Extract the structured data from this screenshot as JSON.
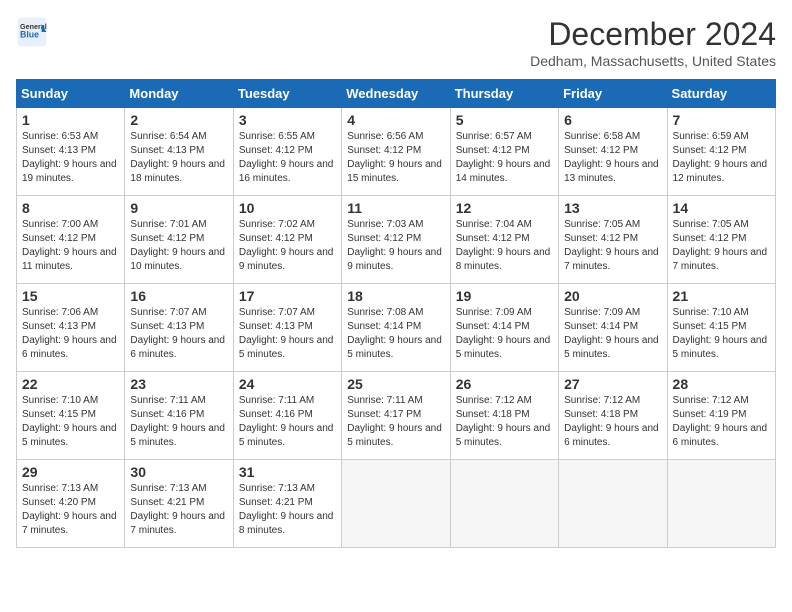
{
  "header": {
    "logo_line1": "General",
    "logo_line2": "Blue",
    "month": "December 2024",
    "location": "Dedham, Massachusetts, United States"
  },
  "weekdays": [
    "Sunday",
    "Monday",
    "Tuesday",
    "Wednesday",
    "Thursday",
    "Friday",
    "Saturday"
  ],
  "weeks": [
    [
      {
        "day": "1",
        "sunrise": "6:53 AM",
        "sunset": "4:13 PM",
        "daylight": "9 hours and 19 minutes."
      },
      {
        "day": "2",
        "sunrise": "6:54 AM",
        "sunset": "4:13 PM",
        "daylight": "9 hours and 18 minutes."
      },
      {
        "day": "3",
        "sunrise": "6:55 AM",
        "sunset": "4:12 PM",
        "daylight": "9 hours and 16 minutes."
      },
      {
        "day": "4",
        "sunrise": "6:56 AM",
        "sunset": "4:12 PM",
        "daylight": "9 hours and 15 minutes."
      },
      {
        "day": "5",
        "sunrise": "6:57 AM",
        "sunset": "4:12 PM",
        "daylight": "9 hours and 14 minutes."
      },
      {
        "day": "6",
        "sunrise": "6:58 AM",
        "sunset": "4:12 PM",
        "daylight": "9 hours and 13 minutes."
      },
      {
        "day": "7",
        "sunrise": "6:59 AM",
        "sunset": "4:12 PM",
        "daylight": "9 hours and 12 minutes."
      }
    ],
    [
      {
        "day": "8",
        "sunrise": "7:00 AM",
        "sunset": "4:12 PM",
        "daylight": "9 hours and 11 minutes."
      },
      {
        "day": "9",
        "sunrise": "7:01 AM",
        "sunset": "4:12 PM",
        "daylight": "9 hours and 10 minutes."
      },
      {
        "day": "10",
        "sunrise": "7:02 AM",
        "sunset": "4:12 PM",
        "daylight": "9 hours and 9 minutes."
      },
      {
        "day": "11",
        "sunrise": "7:03 AM",
        "sunset": "4:12 PM",
        "daylight": "9 hours and 9 minutes."
      },
      {
        "day": "12",
        "sunrise": "7:04 AM",
        "sunset": "4:12 PM",
        "daylight": "9 hours and 8 minutes."
      },
      {
        "day": "13",
        "sunrise": "7:05 AM",
        "sunset": "4:12 PM",
        "daylight": "9 hours and 7 minutes."
      },
      {
        "day": "14",
        "sunrise": "7:05 AM",
        "sunset": "4:12 PM",
        "daylight": "9 hours and 7 minutes."
      }
    ],
    [
      {
        "day": "15",
        "sunrise": "7:06 AM",
        "sunset": "4:13 PM",
        "daylight": "9 hours and 6 minutes."
      },
      {
        "day": "16",
        "sunrise": "7:07 AM",
        "sunset": "4:13 PM",
        "daylight": "9 hours and 6 minutes."
      },
      {
        "day": "17",
        "sunrise": "7:07 AM",
        "sunset": "4:13 PM",
        "daylight": "9 hours and 5 minutes."
      },
      {
        "day": "18",
        "sunrise": "7:08 AM",
        "sunset": "4:14 PM",
        "daylight": "9 hours and 5 minutes."
      },
      {
        "day": "19",
        "sunrise": "7:09 AM",
        "sunset": "4:14 PM",
        "daylight": "9 hours and 5 minutes."
      },
      {
        "day": "20",
        "sunrise": "7:09 AM",
        "sunset": "4:14 PM",
        "daylight": "9 hours and 5 minutes."
      },
      {
        "day": "21",
        "sunrise": "7:10 AM",
        "sunset": "4:15 PM",
        "daylight": "9 hours and 5 minutes."
      }
    ],
    [
      {
        "day": "22",
        "sunrise": "7:10 AM",
        "sunset": "4:15 PM",
        "daylight": "9 hours and 5 minutes."
      },
      {
        "day": "23",
        "sunrise": "7:11 AM",
        "sunset": "4:16 PM",
        "daylight": "9 hours and 5 minutes."
      },
      {
        "day": "24",
        "sunrise": "7:11 AM",
        "sunset": "4:16 PM",
        "daylight": "9 hours and 5 minutes."
      },
      {
        "day": "25",
        "sunrise": "7:11 AM",
        "sunset": "4:17 PM",
        "daylight": "9 hours and 5 minutes."
      },
      {
        "day": "26",
        "sunrise": "7:12 AM",
        "sunset": "4:18 PM",
        "daylight": "9 hours and 5 minutes."
      },
      {
        "day": "27",
        "sunrise": "7:12 AM",
        "sunset": "4:18 PM",
        "daylight": "9 hours and 6 minutes."
      },
      {
        "day": "28",
        "sunrise": "7:12 AM",
        "sunset": "4:19 PM",
        "daylight": "9 hours and 6 minutes."
      }
    ],
    [
      {
        "day": "29",
        "sunrise": "7:13 AM",
        "sunset": "4:20 PM",
        "daylight": "9 hours and 7 minutes."
      },
      {
        "day": "30",
        "sunrise": "7:13 AM",
        "sunset": "4:21 PM",
        "daylight": "9 hours and 7 minutes."
      },
      {
        "day": "31",
        "sunrise": "7:13 AM",
        "sunset": "4:21 PM",
        "daylight": "9 hours and 8 minutes."
      },
      null,
      null,
      null,
      null
    ]
  ],
  "labels": {
    "sunrise": "Sunrise:",
    "sunset": "Sunset:",
    "daylight": "Daylight:"
  }
}
